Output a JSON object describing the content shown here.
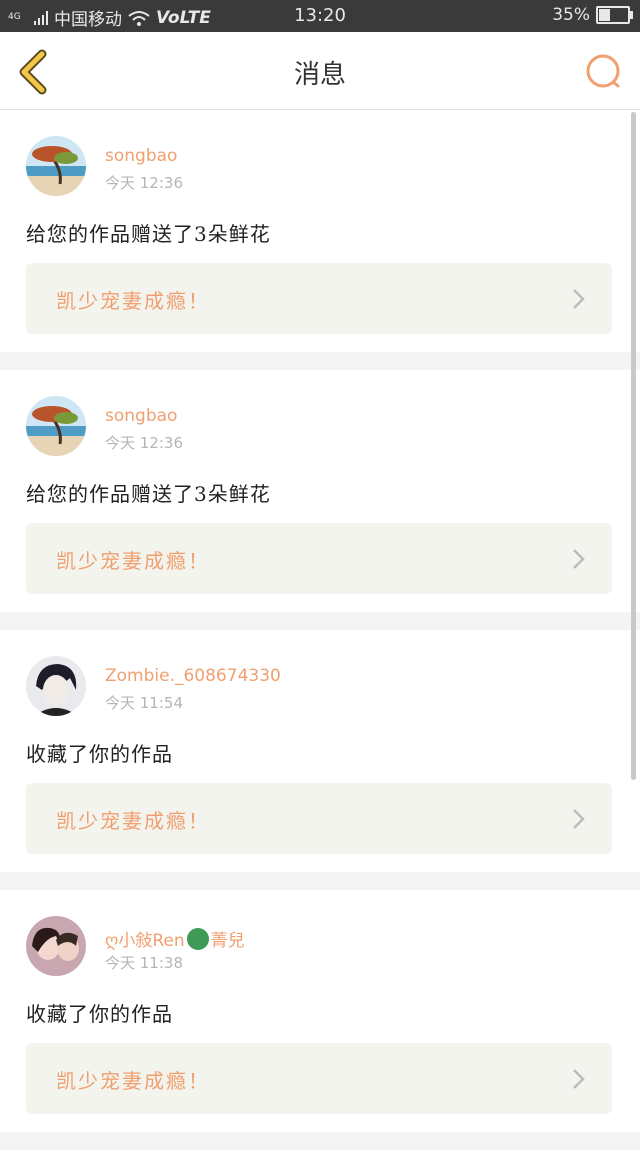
{
  "status_bar": {
    "network": "4G",
    "carrier": "中国移动",
    "volte": "VoLTE",
    "time": "13:20",
    "battery": "35%",
    "battery_level": 0.35
  },
  "nav": {
    "title": "消息",
    "back_icon": "chevron-left-icon",
    "search_icon": "search-icon"
  },
  "colors": {
    "accent": "#f0a070",
    "card_bg": "#f4f4ef",
    "back": "#f3c84a"
  },
  "messages": [
    {
      "user": "songbao",
      "time": "今天 12:36",
      "action": "给您的作品赠送了3朵鲜花",
      "work": "凯少宠妻成瘾！"
    },
    {
      "user": "songbao",
      "time": "今天 12:36",
      "action": "给您的作品赠送了3朵鲜花",
      "work": "凯少宠妻成瘾！"
    },
    {
      "user": "Zombie._608674330",
      "time": "今天 11:54",
      "action": "收藏了你的作品",
      "work": "凯少宠妻成瘾！"
    },
    {
      "user_prefix": "ღ小敍Ren",
      "user_suffix": "菁兒",
      "time": "今天 11:38",
      "action": "收藏了你的作品",
      "work": "凯少宠妻成瘾！"
    }
  ]
}
